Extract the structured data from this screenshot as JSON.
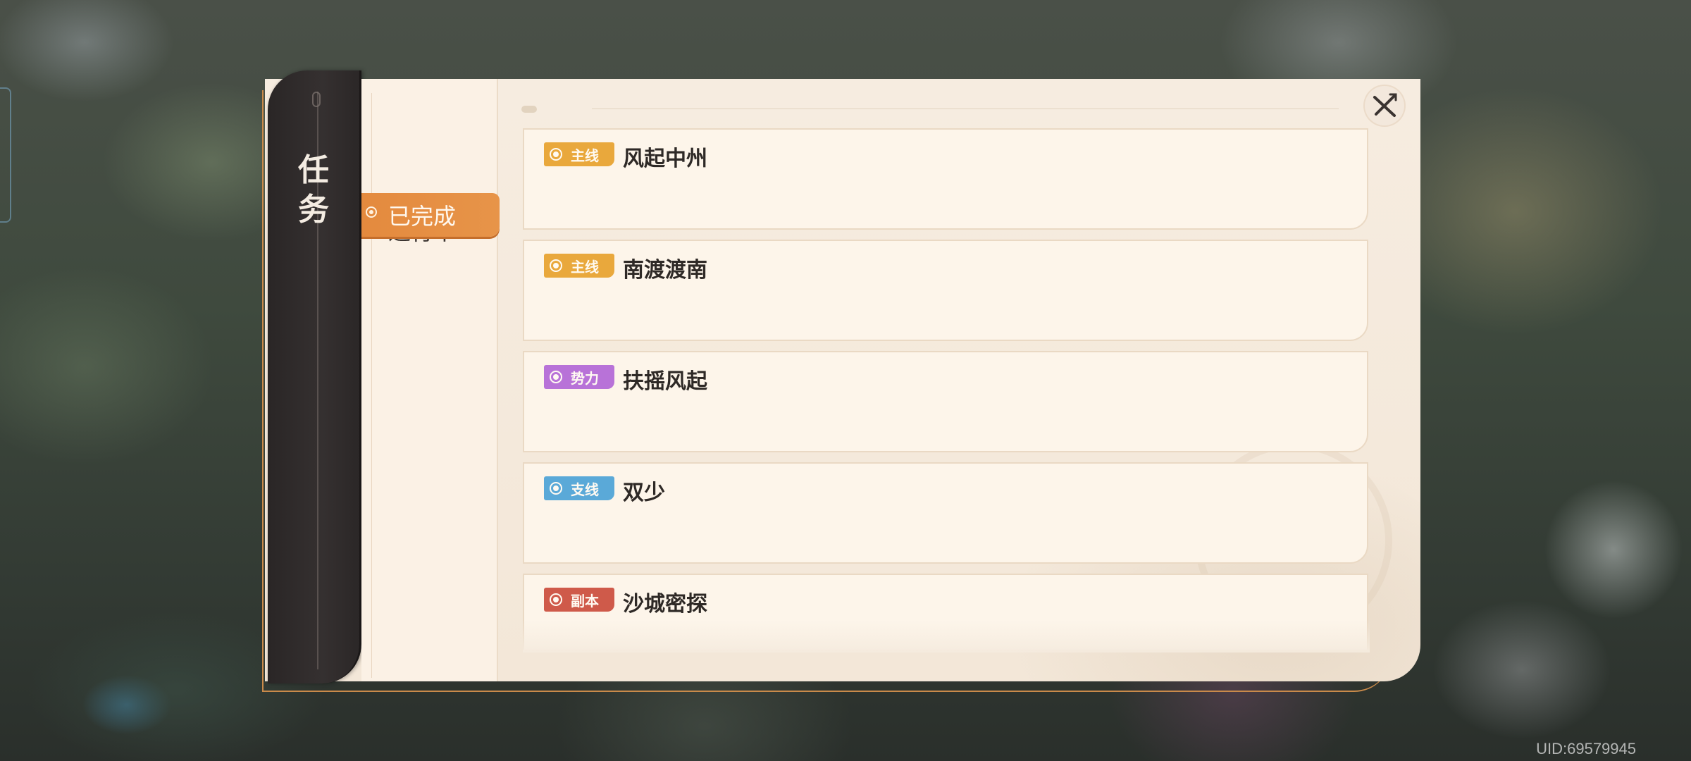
{
  "panel": {
    "title_chars": [
      "任",
      "务"
    ]
  },
  "tabs": [
    {
      "label": "进行中",
      "selected": false
    },
    {
      "label": "已完成",
      "selected": true
    }
  ],
  "quests": [
    {
      "tag": "主线",
      "tag_color": "#e9a83c",
      "name": "风起中州"
    },
    {
      "tag": "主线",
      "tag_color": "#e9a83c",
      "name": "南渡渡南"
    },
    {
      "tag": "势力",
      "tag_color": "#b872d8",
      "name": "扶摇风起"
    },
    {
      "tag": "支线",
      "tag_color": "#5aa9d8",
      "name": "双少"
    },
    {
      "tag": "副本",
      "tag_color": "#cf5a4a",
      "name": "沙城密探"
    }
  ],
  "footer": {
    "uid": "UID:69579945"
  },
  "icons": {
    "close": "close-icon",
    "tag": "target-circle-icon"
  },
  "colors": {
    "accent": "#e48a3e",
    "panel_bg": "#f6ece0",
    "title_bar": "#2f2b2b"
  }
}
